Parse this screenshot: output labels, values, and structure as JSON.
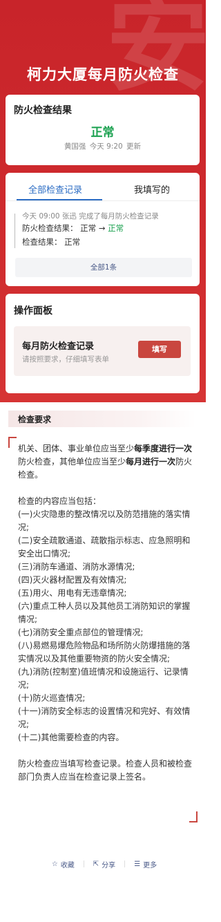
{
  "header": {
    "title": "柯力大厦每月防火检查",
    "watermark": "安"
  },
  "result_card": {
    "title": "防火检查结果",
    "status": "正常",
    "updated_by": "黄国强",
    "updated_time": "今天 9:20",
    "updated_suffix": "更新",
    "status_color": "#1aa14f"
  },
  "records_card": {
    "tabs": [
      {
        "label": "全部检查记录",
        "active": true
      },
      {
        "label": "我填写的",
        "active": false
      }
    ],
    "log": {
      "line1": "今天 09:00  张迅 完成了每月防火检查记录",
      "field1_label": "防火检查结果：",
      "field1_old": "正常",
      "field1_arrow": "→",
      "field1_new": "正常",
      "field2_label": "检查结果：",
      "field2_value": "正常"
    },
    "all_button": "全部1条"
  },
  "panel_card": {
    "title": "操作面板",
    "item_title": "每月防火检查记录",
    "item_sub": "请按照要求，仔细填写表单",
    "fill_button": "填写",
    "button_color": "#c9463f"
  },
  "requirements": {
    "title": "检查要求",
    "p1_a": "机关、团体、事业单位应当至少",
    "p1_b": "每季度进行一次",
    "p1_c": "防火检查，其他单位应当至少",
    "p1_d": "每月进行一次",
    "p1_e": "防火检查。",
    "intro": "检查的内容应当包括：",
    "items": [
      "(一)火灾隐患的整改情况以及防范措施的落实情况;",
      "(二)安全疏散通道、疏散指示标志、应急照明和安全出口情况;",
      "(三)消防车通道、消防水源情况;",
      "(四)灭火器材配置及有效情况;",
      "(五)用火、用电有无违章情况;",
      "(六)重点工种人员以及其他员工消防知识的掌握情况;",
      "(七)消防安全重点部位的管理情况;",
      "(八)易燃易爆危险物品和场所防火防爆措施的落实情况以及其他重要物资的防火安全情况;",
      "(九)消防(控制室)值班情况和设施运行、记录情况;",
      "(十)防火巡查情况;",
      "(十一)消防安全标志的设置情况和完好、有效情况;",
      "(十二)其他需要检查的内容。"
    ],
    "closing": "防火检查应当填写检查记录。检查人员和被检查部门负责人应当在检查记录上签名。"
  },
  "bottom_bar": {
    "favorite": "收藏",
    "share": "分享",
    "more": "更多",
    "favorite_icon": "star-icon",
    "share_icon": "share-icon",
    "more_icon": "menu-icon"
  },
  "colors": {
    "header_red": "#cf2b2e",
    "accent_blue": "#2b6cc4"
  }
}
